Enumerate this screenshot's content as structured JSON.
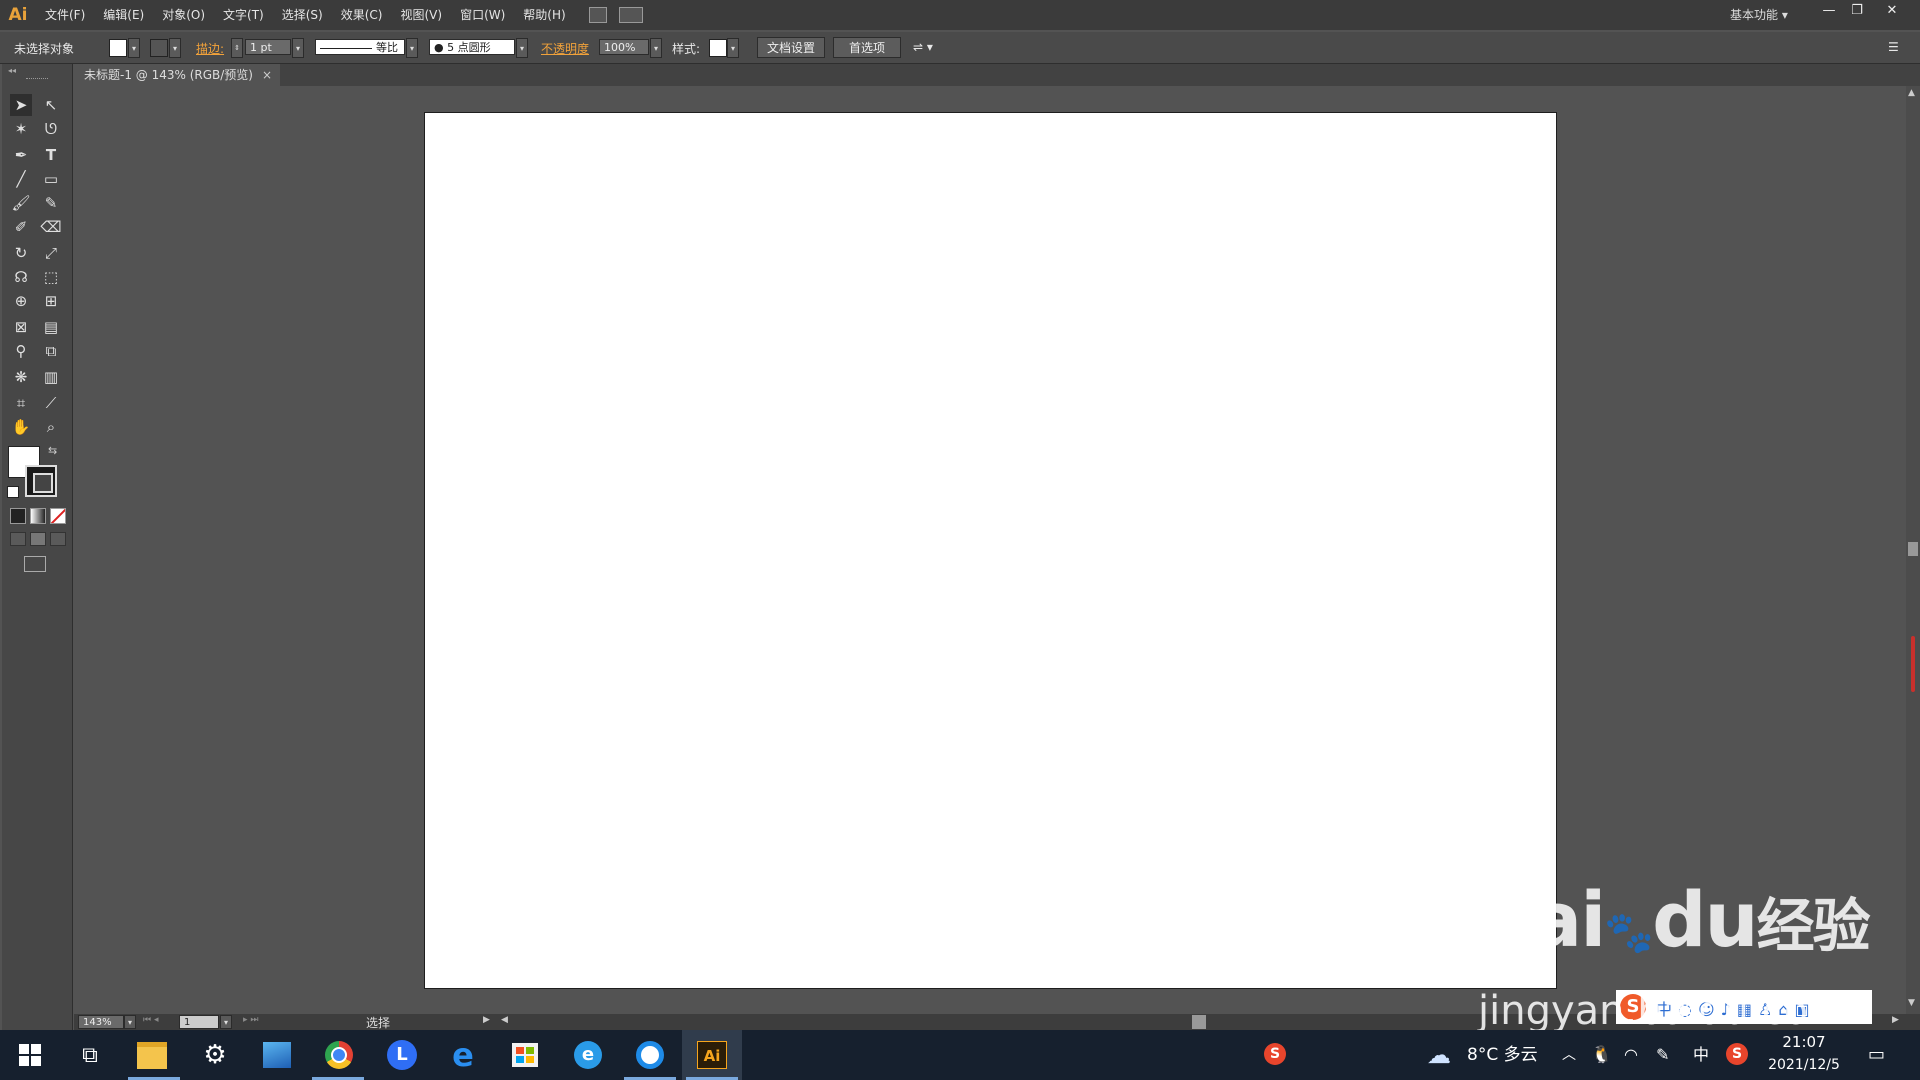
{
  "app": {
    "logo": "Ai"
  },
  "menu": [
    "文件(F)",
    "编辑(E)",
    "对象(O)",
    "文字(T)",
    "选择(S)",
    "效果(C)",
    "视图(V)",
    "窗口(W)",
    "帮助(H)"
  ],
  "workspace": "基本功能",
  "control": {
    "no_selection": "未选择对象",
    "stroke_label": "描边:",
    "stroke_value": "1 pt",
    "stroke_profile": "等比",
    "brush": "5 点圆形",
    "opacity_label": "不透明度",
    "opacity_value": "100%",
    "style_label": "样式:",
    "doc_setup": "文档设置",
    "preferences": "首选项"
  },
  "document": {
    "tab_title": "未标题-1 @ 143% (RGB/预览)",
    "close": "×"
  },
  "status": {
    "zoom": "143%",
    "artboard": "1",
    "tool": "选择"
  },
  "taskbar": {
    "weather": "8°C 多云",
    "ime": "中",
    "time": "21:07",
    "date": "2021/12/5",
    "ai_label": "Ai"
  },
  "watermark": {
    "brand": "Bai",
    "brand2": "du",
    "suffix": "经验",
    "url": "jingyan.baidu.com"
  },
  "colors": {
    "accent": "#f2a23a",
    "taskbar": "#16202e",
    "canvas": "#535353"
  }
}
